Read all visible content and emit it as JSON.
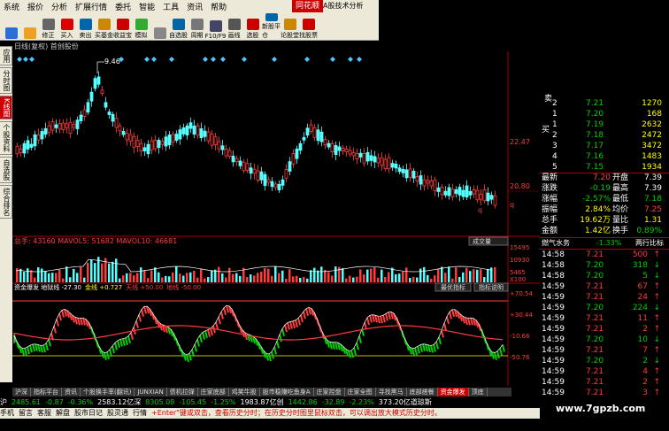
{
  "menu": [
    "系统",
    "报价",
    "分析",
    "扩展行情",
    "委托",
    "智能",
    "工具",
    "资讯",
    "帮助"
  ],
  "app_title": "同花顺",
  "app_subtitle": "A股技术分析",
  "toolbar": [
    {
      "label": "",
      "color": "#2a6fd6"
    },
    {
      "label": "",
      "color": "#f0a020"
    },
    {
      "label": "修正",
      "color": "#666"
    },
    {
      "label": "买入",
      "color": "#d00"
    },
    {
      "label": "卖出",
      "color": "#06a"
    },
    {
      "label": "买基金",
      "color": "#c80"
    },
    {
      "label": "收益宝",
      "color": "#c00"
    },
    {
      "label": "模拟",
      "color": "#3a3"
    },
    {
      "label": "",
      "color": "#888"
    },
    {
      "label": "自选股",
      "color": "#06a"
    },
    {
      "label": "周期",
      "color": "#777"
    },
    {
      "label": "F10/F9",
      "color": "#446"
    },
    {
      "label": "画线",
      "color": "#555"
    },
    {
      "label": "选股",
      "color": "#c00"
    },
    {
      "label": "新股平仓",
      "color": "#06a"
    },
    {
      "label": "论股堂",
      "color": "#c80"
    },
    {
      "label": "找股票",
      "color": "#c00"
    }
  ],
  "chart_header": "日线(复权)  首创股份",
  "side_tabs": [
    {
      "label": "应用",
      "active": false
    },
    {
      "label": "分时图",
      "active": false
    },
    {
      "label": "K线图",
      "active": true
    },
    {
      "label": "个股资料",
      "active": false
    },
    {
      "label": "自选股",
      "active": false
    },
    {
      "label": "综合排名",
      "active": false
    }
  ],
  "price_axis": [
    "22.47",
    "20.80",
    "q"
  ],
  "vol_panel": {
    "header": "总手: 43160  MAVOL5: 51682  MAVOL10: 46681",
    "dropdown": "成交量",
    "axis": [
      "15495",
      "10930",
      "5465",
      "X100"
    ]
  },
  "ind_panel": {
    "header_parts": [
      {
        "t": "资金爆发 地狱线 -27.30",
        "c": "#fff"
      },
      {
        "t": "金线 +0.727",
        "c": "#ffff00"
      },
      {
        "t": "天线 +50.00",
        "c": "#ff3c3c"
      },
      {
        "t": "地线 -50.00",
        "c": "#ff3c3c"
      }
    ],
    "btn1": "最优指标",
    "btn2": "指标说明",
    "axis": [
      "+70.54",
      "+30.44",
      "-10.66",
      "-50.76"
    ]
  },
  "order_book": {
    "sell_label": "卖",
    "buy_label": "买",
    "sell": [
      {
        "n": "2",
        "p": "7.21",
        "v": "1270"
      },
      {
        "n": "1",
        "p": "7.20",
        "v": "168"
      }
    ],
    "buy": [
      {
        "n": "1",
        "p": "7.19",
        "v": "2632"
      },
      {
        "n": "2",
        "p": "7.18",
        "v": "2472"
      },
      {
        "n": "3",
        "p": "7.17",
        "v": "3472"
      },
      {
        "n": "4",
        "p": "7.16",
        "v": "1483"
      },
      {
        "n": "5",
        "p": "7.15",
        "v": "1934"
      }
    ]
  },
  "stats": [
    {
      "l": "最新",
      "v": "7.20",
      "c": "#ff3c3c",
      "l2": "开盘",
      "v2": "7.39",
      "c2": "#fff"
    },
    {
      "l": "涨跌",
      "v": "-0.19",
      "c": "#00d000",
      "l2": "最高",
      "v2": "7.39",
      "c2": "#fff"
    },
    {
      "l": "涨幅",
      "v": "-2.57%",
      "c": "#00d000",
      "l2": "最低",
      "v2": "7.18",
      "c2": "#00d000"
    },
    {
      "l": "振幅",
      "v": "2.84%",
      "c": "#ffff00",
      "l2": "均价",
      "v2": "7.25",
      "c2": "#ff3c3c"
    },
    {
      "l": "总手",
      "v": "19.62万",
      "c": "#ffff00",
      "l2": "量比",
      "v2": "1.31",
      "c2": "#ffff00"
    },
    {
      "l": "金额",
      "v": "1.42亿",
      "c": "#ffff00",
      "l2": "换手",
      "v2": "0.89%",
      "c2": "#00d000"
    }
  ],
  "sector": {
    "name": "燃气水务",
    "change": "-1.33%",
    "link": "两行比标"
  },
  "ticks": [
    {
      "t": "14:58",
      "p": "7.21",
      "v": "500",
      "d": "up"
    },
    {
      "t": "14:58",
      "p": "7.20",
      "v": "318",
      "d": "down"
    },
    {
      "t": "14:58",
      "p": "7.20",
      "v": "5",
      "d": "down"
    },
    {
      "t": "14:59",
      "p": "7.21",
      "v": "67",
      "d": "up"
    },
    {
      "t": "14:59",
      "p": "7.21",
      "v": "24",
      "d": "up"
    },
    {
      "t": "14:59",
      "p": "7.20",
      "v": "224",
      "d": "down"
    },
    {
      "t": "14:59",
      "p": "7.21",
      "v": "11",
      "d": "up"
    },
    {
      "t": "14:59",
      "p": "7.21",
      "v": "2",
      "d": "up"
    },
    {
      "t": "14:59",
      "p": "7.20",
      "v": "10",
      "d": "down"
    },
    {
      "t": "14:59",
      "p": "7.21",
      "v": "7",
      "d": "up"
    },
    {
      "t": "14:59",
      "p": "7.20",
      "v": "2",
      "d": "down"
    },
    {
      "t": "14:59",
      "p": "7.21",
      "v": "4",
      "d": "up"
    },
    {
      "t": "14:59",
      "p": "7.21",
      "v": "2",
      "d": "up"
    },
    {
      "t": "14:59",
      "p": "7.21",
      "v": "3",
      "d": "up"
    }
  ],
  "bottom_tabs": [
    {
      "l": "沪深",
      "a": false
    },
    {
      "l": "指标平台",
      "a": false
    },
    {
      "l": "资讯",
      "a": false
    },
    {
      "l": "个股换手率(翻讯)",
      "a": false
    },
    {
      "l": "JUNXIAN",
      "a": false
    },
    {
      "l": "债机拉弹",
      "a": false
    },
    {
      "l": "庄家底部",
      "a": false
    },
    {
      "l": "鸡笑牛股",
      "a": false
    },
    {
      "l": "股市稳赚吃鱼身A",
      "a": false
    },
    {
      "l": "庄家控盘",
      "a": false
    },
    {
      "l": "庄家全图",
      "a": false
    },
    {
      "l": "寻找黑马",
      "a": false
    },
    {
      "l": "底部搭餐",
      "a": false
    },
    {
      "l": "资金爆发",
      "a": true
    },
    {
      "l": "顶底",
      "a": false
    }
  ],
  "index_bar": [
    {
      "t": "沪",
      "c": "#fff"
    },
    {
      "t": "2485.61",
      "c": "#00d000"
    },
    {
      "t": "-0.87",
      "c": "#00d000"
    },
    {
      "t": "-0.36%",
      "c": "#00d000"
    },
    {
      "t": "2583.12亿深",
      "c": "#fff"
    },
    {
      "t": "8305.08",
      "c": "#00d000"
    },
    {
      "t": "-105.45",
      "c": "#00d000"
    },
    {
      "t": "-1.25%",
      "c": "#00d000"
    },
    {
      "t": "1983.87亿创",
      "c": "#fff"
    },
    {
      "t": "1442.86",
      "c": "#00d000"
    },
    {
      "t": "-32.89",
      "c": "#00d000"
    },
    {
      "t": "-2.23%",
      "c": "#00d000"
    },
    {
      "t": "373.20亿道琼斯",
      "c": "#fff"
    }
  ],
  "status_bar": {
    "items": [
      "手机",
      "留言",
      "客服",
      "解盘",
      "股市日记",
      "股灵通",
      "行情"
    ],
    "hint": "+Enter\"键或双击，查看历史分时；在历史分时图里鼠标双击，可以调出放大模式历史分时。"
  },
  "watermark": "www.7gpzb.com",
  "marker_label": "9.46",
  "chart_data": {
    "type": "candlestick",
    "candles": [],
    "annotations": [
      "9.46"
    ]
  }
}
